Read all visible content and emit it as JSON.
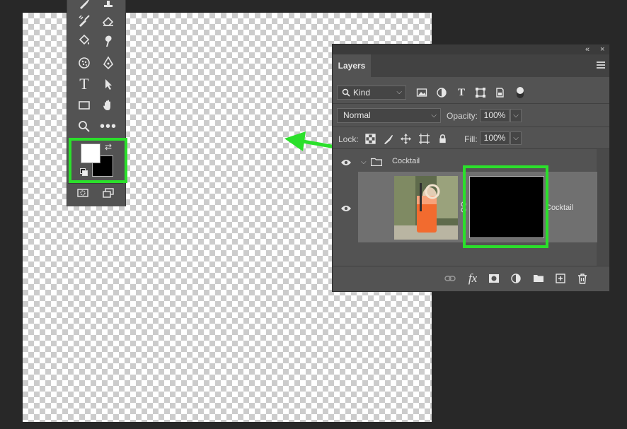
{
  "layers_panel": {
    "tab_label": "Layers",
    "collapse_label": "«",
    "close_label": "×",
    "kind_filter": {
      "label": "Kind",
      "dropdown": "⌵"
    },
    "blend_mode": {
      "value": "Normal",
      "dropdown": "⌵"
    },
    "opacity": {
      "label": "Opacity:",
      "value": "100%",
      "dropdown": "⌵"
    },
    "lock": {
      "label": "Lock:"
    },
    "fill": {
      "label": "Fill:",
      "value": "100%",
      "dropdown": "⌵"
    },
    "group": {
      "name": "Cocktail",
      "expand_chevron": "⌵"
    },
    "layer": {
      "name": "Cocktail"
    },
    "bottom_icons": [
      "link-icon",
      "fx-icon",
      "add-mask-icon",
      "adjustment-layer-icon",
      "new-group-icon",
      "new-layer-icon",
      "trash-icon"
    ],
    "fx_label": "fx"
  },
  "toolbar": {
    "type_tool_label": "T",
    "more_tools_label": "•••",
    "swap_label": "⇄",
    "foreground_color": "#ffffff",
    "background_color": "#000000"
  },
  "colors": {
    "highlight": "#2be02b",
    "panel_bg": "#535353",
    "app_bg": "#282828"
  }
}
